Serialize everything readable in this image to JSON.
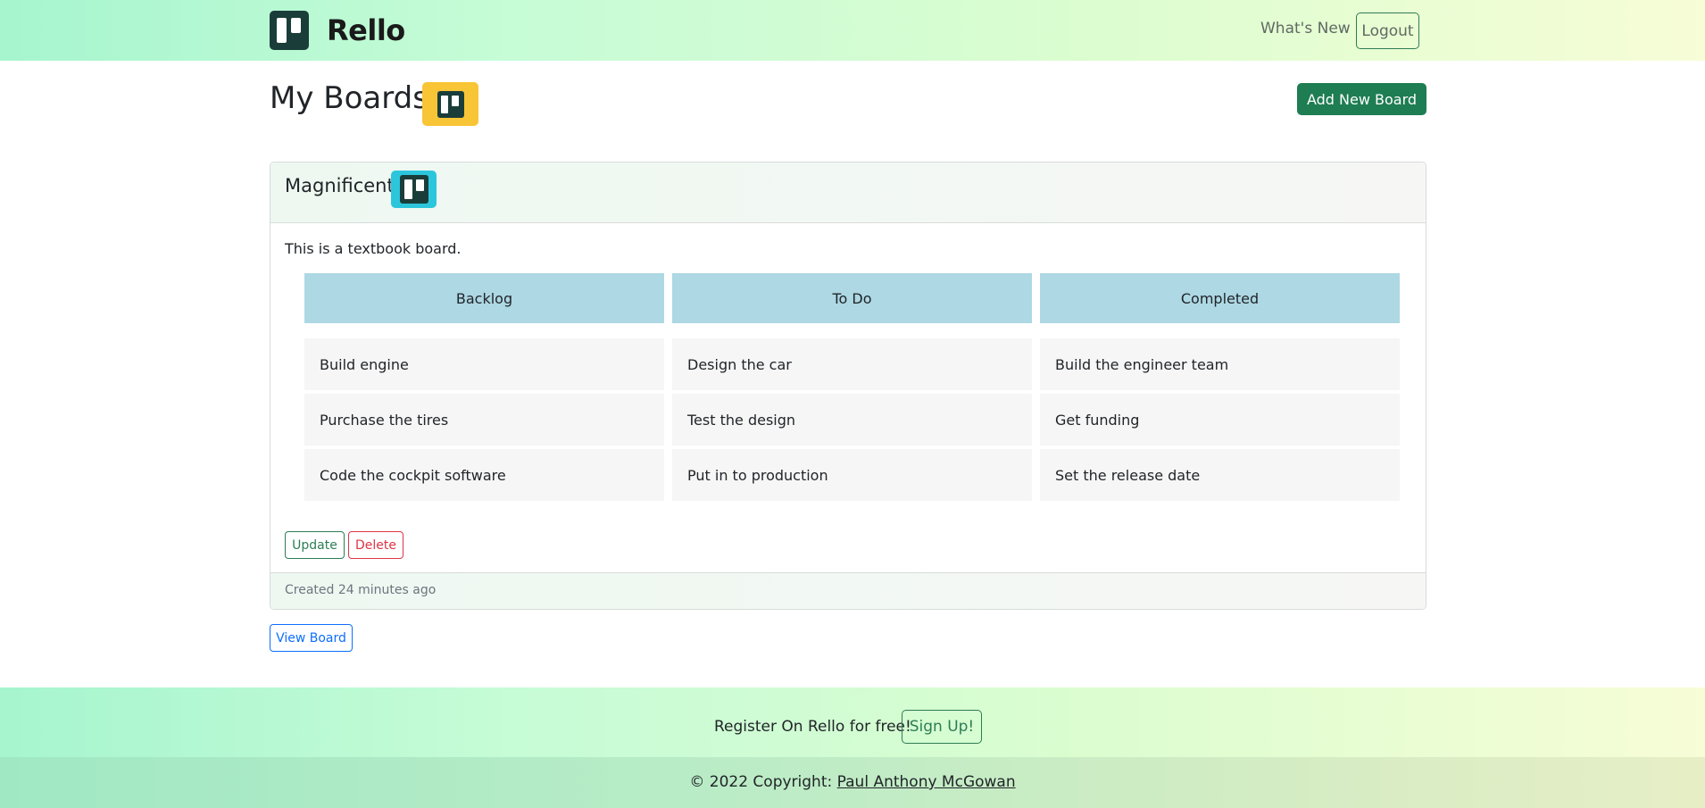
{
  "navbar": {
    "brand": "Rello",
    "whats_new": "What's New",
    "logout": "Logout"
  },
  "page": {
    "title": "My Boards",
    "add_button": "Add New Board"
  },
  "board": {
    "name": "Magnificent",
    "description": "This is a textbook board.",
    "columns": [
      {
        "title": "Backlog",
        "items": [
          "Build engine",
          "Purchase the tires",
          "Code the cockpit software"
        ]
      },
      {
        "title": "To Do",
        "items": [
          "Design the car",
          "Test the design",
          "Put in to production"
        ]
      },
      {
        "title": "Completed",
        "items": [
          "Build the engineer team",
          "Get funding",
          "Set the release date"
        ]
      }
    ],
    "update_button": "Update",
    "delete_button": "Delete",
    "created": "Created 24 minutes ago"
  },
  "view_board_button": "View Board",
  "footer": {
    "register_text": "Register On Rello for free!",
    "signup_button": "Sign Up!",
    "copyright_prefix": "© 2022 Copyright:",
    "author": "Paul Anthony McGowan"
  },
  "colors": {
    "brand_dark": "#1b3d3a",
    "accent_green": "#1e7d52",
    "column_header": "#add8e4",
    "title_icon_bg": "#f8c537",
    "board_icon_bg": "#2cc6dc"
  },
  "icons": {
    "brand": "rello-logo-icon",
    "title": "board-icon",
    "board": "board-icon"
  }
}
